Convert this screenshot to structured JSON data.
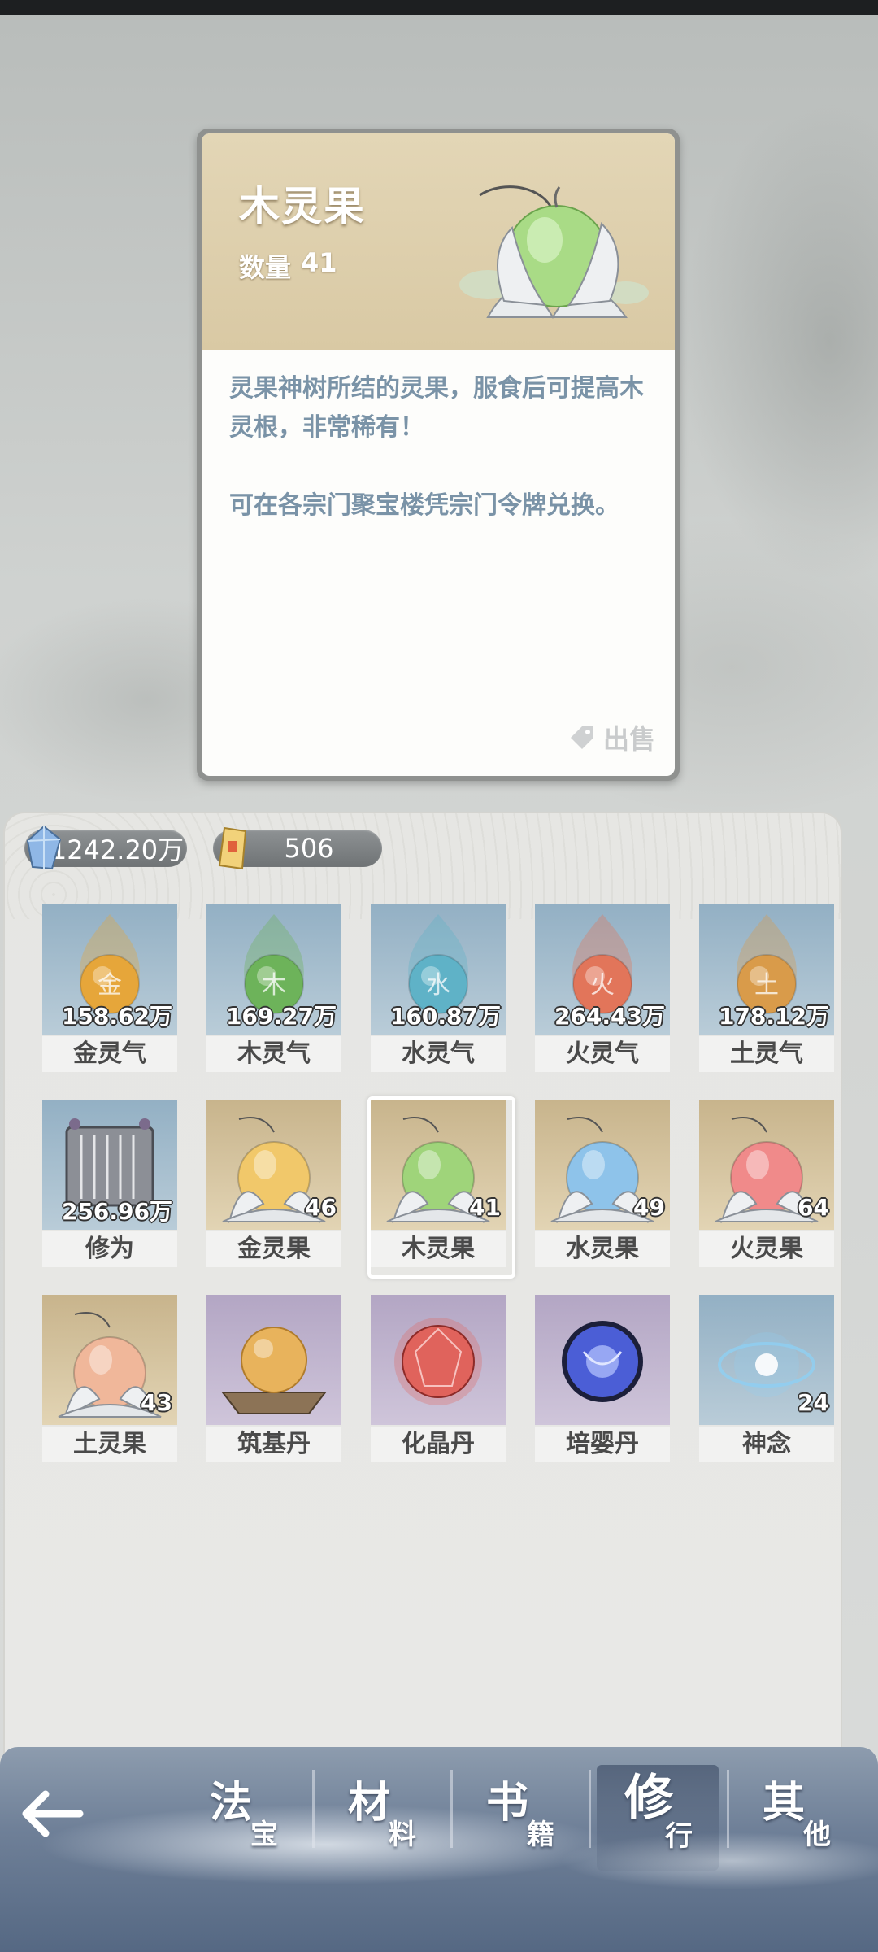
{
  "detail": {
    "title": "木灵果",
    "quantity_label": "数量",
    "quantity_value": "41",
    "description_1": "灵果神树所结的灵果，服食后可提高木灵根，非常稀有！",
    "description_2": "可在各宗门聚宝楼凭宗门令牌兑换。",
    "sell_label": "出售",
    "colors": {
      "header": "#ddd0ad",
      "desc_text": "#7a93a7"
    }
  },
  "currencies": [
    {
      "icon": "blue-crystal-icon",
      "value": "1242.20万"
    },
    {
      "icon": "gold-token-icon",
      "value": "506"
    }
  ],
  "items": [
    {
      "name": "金灵气",
      "count": "158.62万",
      "icon": "gold-qi-orb-icon",
      "bg": "blue",
      "color": "#e6a63a",
      "glyph": "金"
    },
    {
      "name": "木灵气",
      "count": "169.27万",
      "icon": "wood-qi-orb-icon",
      "bg": "blue",
      "color": "#6db35a",
      "glyph": "木"
    },
    {
      "name": "水灵气",
      "count": "160.87万",
      "icon": "water-qi-orb-icon",
      "bg": "blue",
      "color": "#5fb2c7",
      "glyph": "水"
    },
    {
      "name": "火灵气",
      "count": "264.43万",
      "icon": "fire-qi-orb-icon",
      "bg": "blue",
      "color": "#e2755a",
      "glyph": "火"
    },
    {
      "name": "土灵气",
      "count": "178.12万",
      "icon": "earth-qi-orb-icon",
      "bg": "blue",
      "color": "#d99b4a",
      "glyph": "土"
    },
    {
      "name": "修为",
      "count": "256.96万",
      "icon": "scroll-icon",
      "bg": "blue"
    },
    {
      "name": "金灵果",
      "count": "46",
      "icon": "gold-spirit-fruit-icon",
      "bg": "tan",
      "color": "#f1c86a"
    },
    {
      "name": "木灵果",
      "count": "41",
      "icon": "wood-spirit-fruit-icon",
      "bg": "tan",
      "color": "#9fd47a",
      "selected": true
    },
    {
      "name": "水灵果",
      "count": "49",
      "icon": "water-spirit-fruit-icon",
      "bg": "tan",
      "color": "#8ec3ea"
    },
    {
      "name": "火灵果",
      "count": "64",
      "icon": "fire-spirit-fruit-icon",
      "bg": "tan",
      "color": "#f08a8a"
    },
    {
      "name": "土灵果",
      "count": "43",
      "icon": "earth-spirit-fruit-icon",
      "bg": "tan",
      "color": "#f0b79a"
    },
    {
      "name": "筑基丹",
      "count": "",
      "icon": "foundation-pill-icon",
      "bg": "purple",
      "color": "#e8b35c"
    },
    {
      "name": "化晶丹",
      "count": "",
      "icon": "crystal-pill-icon",
      "bg": "purple",
      "color": "#e0635c"
    },
    {
      "name": "培婴丹",
      "count": "",
      "icon": "nascent-pill-icon",
      "bg": "purple",
      "color": "#4b5ed6"
    },
    {
      "name": "神念",
      "count": "24",
      "icon": "divine-sense-icon",
      "bg": "blue",
      "color": "#8ed0f2"
    }
  ],
  "nav": {
    "back_icon": "back-arrow-icon",
    "tabs": [
      {
        "big": "法",
        "small": "宝",
        "active": false
      },
      {
        "big": "材",
        "small": "料",
        "active": false
      },
      {
        "big": "书",
        "small": "籍",
        "active": false
      },
      {
        "big": "修",
        "small": "行",
        "active": true
      },
      {
        "big": "其",
        "small": "他",
        "active": false
      }
    ]
  }
}
